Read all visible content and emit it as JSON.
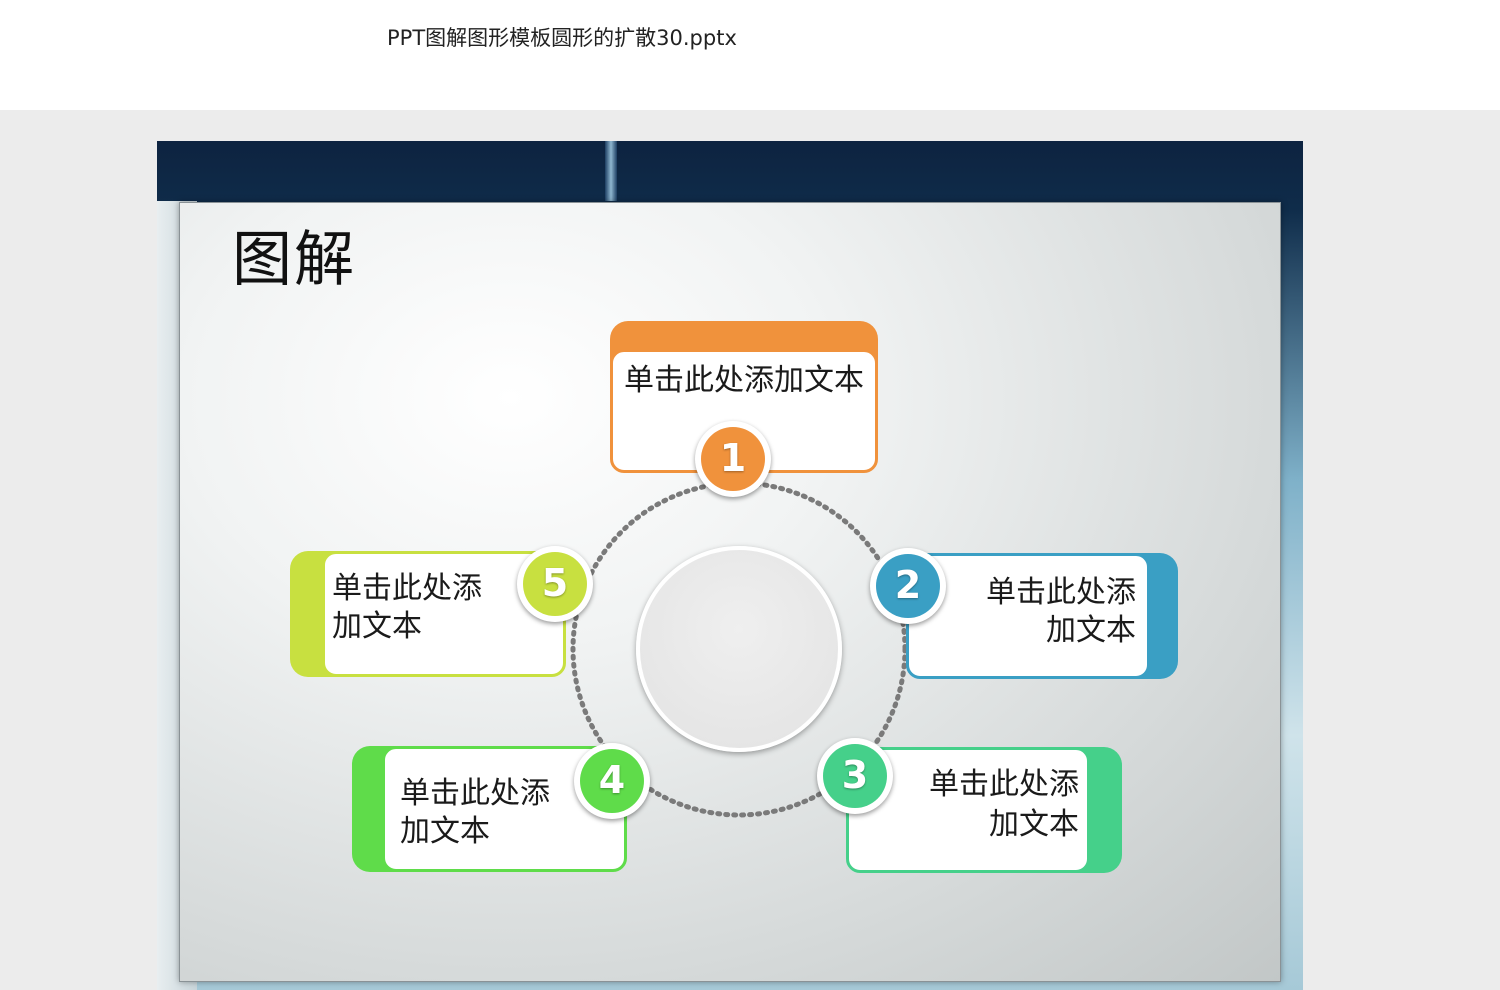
{
  "document": {
    "title": "PPT图解图形模板圆形的扩散30.pptx"
  },
  "slide": {
    "title": "图解",
    "items": [
      {
        "number": "1",
        "text": "单击此处添加文本",
        "color": "#f0923c"
      },
      {
        "number": "2",
        "text_line1": "单击此处添",
        "text_line2": "加文本",
        "color": "#3a9fc4"
      },
      {
        "number": "3",
        "text_line1": "单击此处添",
        "text_line2": "加文本",
        "color": "#45d08a"
      },
      {
        "number": "4",
        "text_line1": "单击此处添",
        "text_line2": "加文本",
        "color": "#5fdc4a"
      },
      {
        "number": "5",
        "text_line1": "单击此处添",
        "text_line2": "加文本",
        "color": "#c8e040"
      }
    ]
  }
}
